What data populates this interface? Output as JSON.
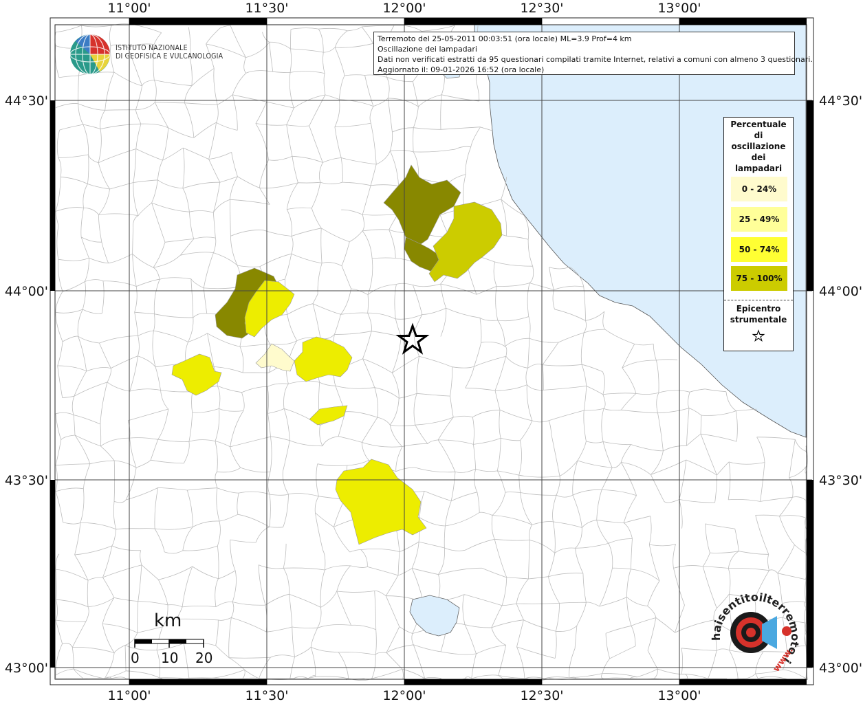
{
  "map": {
    "lon_labels": [
      "11°00'",
      "11°30'",
      "12°00'",
      "12°30'",
      "13°00'"
    ],
    "lat_labels": [
      "44°30'",
      "44°00'",
      "43°30'",
      "43°00'"
    ],
    "colors": {
      "sea": "#dceefc",
      "land": "#ffffff",
      "boundary": "#b9b9b9",
      "class_0_24": "#fffbcd",
      "class_25_49": "#ffff99",
      "class_50_74": "#eded00",
      "class_75_100": "#888800",
      "class_mid": "#cccc00"
    }
  },
  "logo": {
    "line1": "ISTITUTO NAZIONALE",
    "line2": "DI GEOFISICA E VULCANOLOGIA"
  },
  "info": {
    "line1": "Terremoto del 25-05-2011 00:03:51 (ora locale) ML=3.9 Prof=4 km",
    "line2": "Oscillazione dei lampadari",
    "line3": "Dati non verificati estratti da 95 questionari compilati tramite Internet, relativi a comuni con almeno 3 questionari.",
    "line4": "Aggiornato il: 09-01-2026 16:52 (ora locale)"
  },
  "legend": {
    "title_lines": [
      "Percentuale",
      "di",
      "oscillazione",
      "dei",
      "lampadari"
    ],
    "items": [
      {
        "label": "0 - 24%",
        "color": "#fffbcd"
      },
      {
        "label": "25 - 49%",
        "color": "#ffff99"
      },
      {
        "label": "50 - 74%",
        "color": "#ffff33"
      },
      {
        "label": "75 - 100%",
        "color": "#cccc00"
      }
    ],
    "epicenter_lines": [
      "Epicentro",
      "strumentale"
    ],
    "epicenter_icon": "star-icon"
  },
  "scale": {
    "unit": "km",
    "ticks": [
      "0",
      "10",
      "20"
    ]
  },
  "hsit": {
    "text": "haisentitoilterremoto.it",
    "url_text": "www.",
    "icon": "sound-target-icon"
  }
}
